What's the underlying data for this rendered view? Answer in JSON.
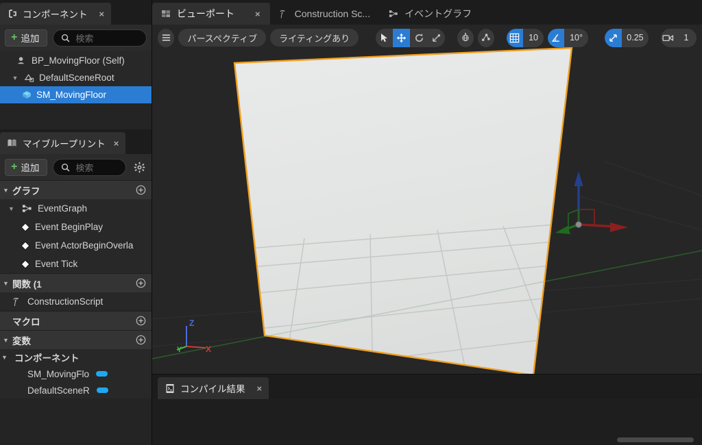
{
  "components_panel": {
    "tab_label": "コンポーネント",
    "tab_icon": "components-icon",
    "close_label": "×",
    "add_label": "追加",
    "search_placeholder": "検索",
    "tree": [
      {
        "label": "BP_MovingFloor (Self)",
        "icon": "blueprint-self-icon",
        "depth": 0,
        "selected": false,
        "has_arrow": false
      },
      {
        "label": "DefaultSceneRoot",
        "icon": "scene-root-icon",
        "depth": 1,
        "selected": false,
        "has_arrow": true
      },
      {
        "label": "SM_MovingFloor",
        "icon": "static-mesh-icon",
        "depth": 2,
        "selected": true,
        "has_arrow": false
      }
    ]
  },
  "myblueprint_panel": {
    "tab_label": "マイブループリント",
    "tab_icon": "blueprint-book-icon",
    "close_label": "×",
    "add_label": "追加",
    "search_placeholder": "検索",
    "gear_icon": "gear-icon",
    "sections": [
      {
        "title": "グラフ",
        "expanded": true,
        "add_icon": "plus-circle-icon",
        "items": [
          {
            "label": "EventGraph",
            "icon": "event-graph-icon",
            "indent": 1,
            "has_arrow": true
          },
          {
            "label": "Event BeginPlay",
            "icon": "event-node-icon",
            "indent": 2,
            "has_arrow": false
          },
          {
            "label": "Event ActorBeginOverla",
            "icon": "event-node-icon",
            "indent": 2,
            "has_arrow": false
          },
          {
            "label": "Event Tick",
            "icon": "event-node-icon",
            "indent": 2,
            "has_arrow": false
          }
        ]
      },
      {
        "title": "関数 (1",
        "expanded": true,
        "add_icon": "plus-circle-icon",
        "items": [
          {
            "label": "ConstructionScript",
            "icon": "function-icon",
            "indent": 1,
            "has_arrow": false
          }
        ]
      },
      {
        "title": "マクロ",
        "expanded": false,
        "add_icon": "plus-circle-icon",
        "items": []
      },
      {
        "title": "変数",
        "expanded": true,
        "add_icon": "plus-circle-icon",
        "items": []
      }
    ],
    "variables_group": {
      "title": "コンポーネント",
      "expanded": true,
      "variables": [
        {
          "label": "SM_MovingFlo",
          "pill_color": "#1fa8f0"
        },
        {
          "label": "DefaultSceneR",
          "pill_color": "#1fa8f0"
        }
      ]
    }
  },
  "main_tabs": [
    {
      "label": "ビューポート",
      "icon": "viewport-icon",
      "active": true,
      "closable": true,
      "close_label": "×"
    },
    {
      "label": "Construction Sc...",
      "icon": "function-icon",
      "active": false,
      "closable": false
    },
    {
      "label": "イベントグラフ",
      "icon": "event-graph-icon",
      "active": false,
      "closable": false
    }
  ],
  "viewport_toolbar": {
    "menu_icon": "hamburger-menu-icon",
    "view_mode": "パースペクティブ",
    "lighting_mode": "ライティングあり",
    "transform_tools": [
      {
        "name": "select-tool",
        "icon": "cursor-arrow-icon",
        "active": false
      },
      {
        "name": "move-tool",
        "icon": "move-arrows-icon",
        "active": true
      },
      {
        "name": "rotate-tool",
        "icon": "rotate-icon",
        "active": false
      },
      {
        "name": "scale-tool",
        "icon": "scale-icon",
        "active": false
      }
    ],
    "coord_system": {
      "icon": "world-coords-icon",
      "active": false
    },
    "surface_snap": {
      "icon": "surface-snap-icon",
      "active": false
    },
    "grid_snap": {
      "icon": "grid-icon",
      "active": true,
      "value": "10"
    },
    "angle_snap": {
      "icon": "angle-icon",
      "active": true,
      "value": "10°"
    },
    "scale_snap": {
      "icon": "scale-snap-icon",
      "active": true,
      "value": "0.25"
    },
    "camera_speed": {
      "icon": "camera-icon",
      "active": false,
      "value": "1"
    }
  },
  "viewport_scene": {
    "axis_indicator": {
      "x_label": "X",
      "y_label": "Y",
      "z_label": "Z",
      "x_color": "#d13b3b",
      "y_color": "#3fc040",
      "z_color": "#4a6ed8"
    },
    "gizmo": {
      "type": "translate",
      "x_color": "#8c1f1f",
      "y_color": "#1f6a1f",
      "z_color": "#243f8c"
    },
    "selected_mesh": {
      "name": "SM_MovingFloor",
      "outline_color": "#f0a020",
      "surface_color": "#e2e4e3"
    },
    "background_color": "#262626"
  },
  "compile_panel": {
    "tab_label": "コンパイル結果",
    "tab_icon": "compile-results-icon",
    "close_label": "×",
    "content": ""
  },
  "colors": {
    "accent_blue": "#2b7dd4",
    "selection_orange": "#f0a020",
    "add_green": "#64c264",
    "panel_bg": "#242424",
    "tab_bg": "#303030"
  }
}
